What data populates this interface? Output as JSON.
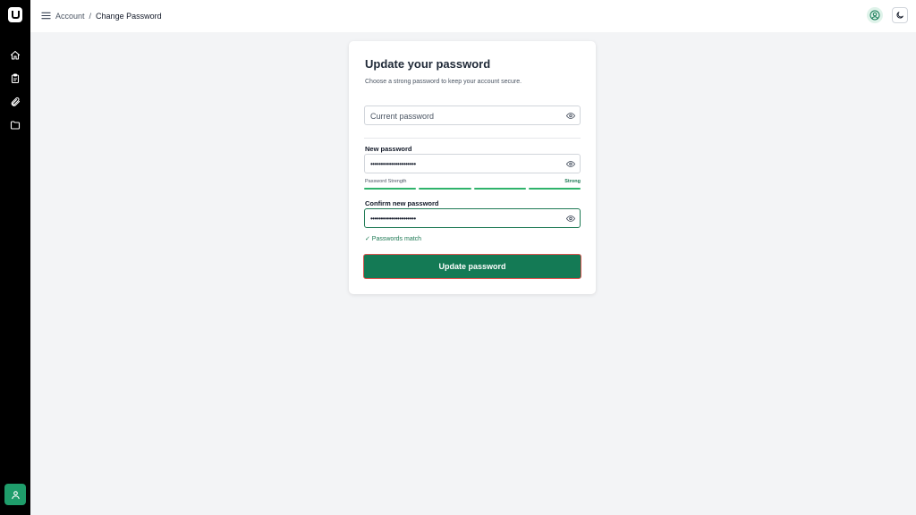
{
  "colors": {
    "sidebar_bg": "#000000",
    "accent": "#147a55",
    "accent_light": "#2fb36b",
    "success_text": "#1f7a55",
    "submit_border": "#d9534f",
    "page_bg": "#f3f4f6"
  },
  "sidebar": {
    "logo_icon": "app-logo-icon",
    "items": [
      {
        "icon": "home-icon"
      },
      {
        "icon": "clipboard-icon"
      },
      {
        "icon": "paperclip-icon"
      },
      {
        "icon": "folder-icon"
      }
    ],
    "bottom_icon": "user-icon"
  },
  "header": {
    "menu_icon": "hamburger-menu-icon",
    "breadcrumb": {
      "parent": "Account",
      "separator": "/",
      "current": "Change Password"
    },
    "profile_icon": "user-circle-icon",
    "theme_icon": "moon-icon"
  },
  "form": {
    "title": "Update your password",
    "subtitle": "Choose a strong password to keep your account secure.",
    "current_password": {
      "placeholder": "Current password",
      "value": ""
    },
    "new_password": {
      "label": "New password",
      "value": "••••••••••••••••••••••"
    },
    "strength": {
      "label": "Password Strength",
      "value": "Strong",
      "level": 4,
      "max": 4
    },
    "confirm_password": {
      "label": "Confirm new password",
      "value": "••••••••••••••••••••••"
    },
    "match_message": "✓ Passwords match",
    "submit_label": "Update password"
  }
}
